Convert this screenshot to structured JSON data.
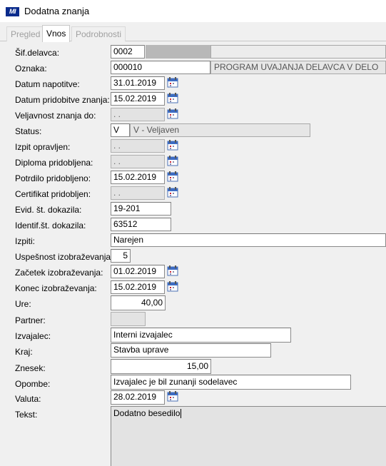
{
  "window": {
    "title": "Dodatna znanja",
    "logo": "MI"
  },
  "tabs": [
    {
      "label": "Pregled",
      "state": "disabled"
    },
    {
      "label": "Vnos",
      "state": "active"
    },
    {
      "label": "Podrobnosti",
      "state": "disabled"
    }
  ],
  "form": {
    "sif_delavca": {
      "label": "Šif.delavca:",
      "value": "0002"
    },
    "oznaka": {
      "label": "Oznaka:",
      "value": "000010",
      "description": "PROGRAM UVAJANJA DELAVCA V DELO"
    },
    "datum_napotitve": {
      "label": "Datum napotitve:",
      "value": "31.01.2019"
    },
    "datum_pridobitve": {
      "label": "Datum pridobitve znanja:",
      "value": "15.02.2019"
    },
    "veljavnost": {
      "label": "Veljavnost znanja do:",
      "value": " .  ."
    },
    "status": {
      "label": "Status:",
      "value": "V",
      "description": "V - Veljaven"
    },
    "izpit": {
      "label": "Izpit opravljen:",
      "value": " .  ."
    },
    "diploma": {
      "label": "Diploma pridobljena:",
      "value": " .  ."
    },
    "potrdilo": {
      "label": "Potrdilo pridobljeno:",
      "value": "15.02.2019"
    },
    "certifikat": {
      "label": "Certifikat pridobljen:",
      "value": " .  ."
    },
    "evid_dokazila": {
      "label": "Evid. št. dokazila:",
      "value": "19-201"
    },
    "identif_dokazila": {
      "label": "Identif.št. dokazila:",
      "value": "63512"
    },
    "izpiti": {
      "label": "Izpiti:",
      "value": "Narejen"
    },
    "uspesnost": {
      "label": "Uspešnost izobraževanja:",
      "value": "5"
    },
    "zacetek": {
      "label": "Začetek izobraževanja:",
      "value": "01.02.2019"
    },
    "konec": {
      "label": "Konec izobraževanja:",
      "value": "15.02.2019"
    },
    "ure": {
      "label": "Ure:",
      "value": "40,00"
    },
    "partner": {
      "label": "Partner:",
      "value": ""
    },
    "izvajalec": {
      "label": "Izvajalec:",
      "value": "Interni izvajalec"
    },
    "kraj": {
      "label": "Kraj:",
      "value": "Stavba uprave"
    },
    "znesek": {
      "label": "Znesek:",
      "value": "15,00"
    },
    "opombe": {
      "label": "Opombe:",
      "value": "Izvajalec je bil zunanji sodelavec"
    },
    "valuta": {
      "label": "Valuta:",
      "value": "28.02.2019"
    },
    "tekst": {
      "label": "Tekst:",
      "value": "Dodatno besedilo"
    }
  },
  "icons": {
    "calendar": "calendar-icon"
  }
}
